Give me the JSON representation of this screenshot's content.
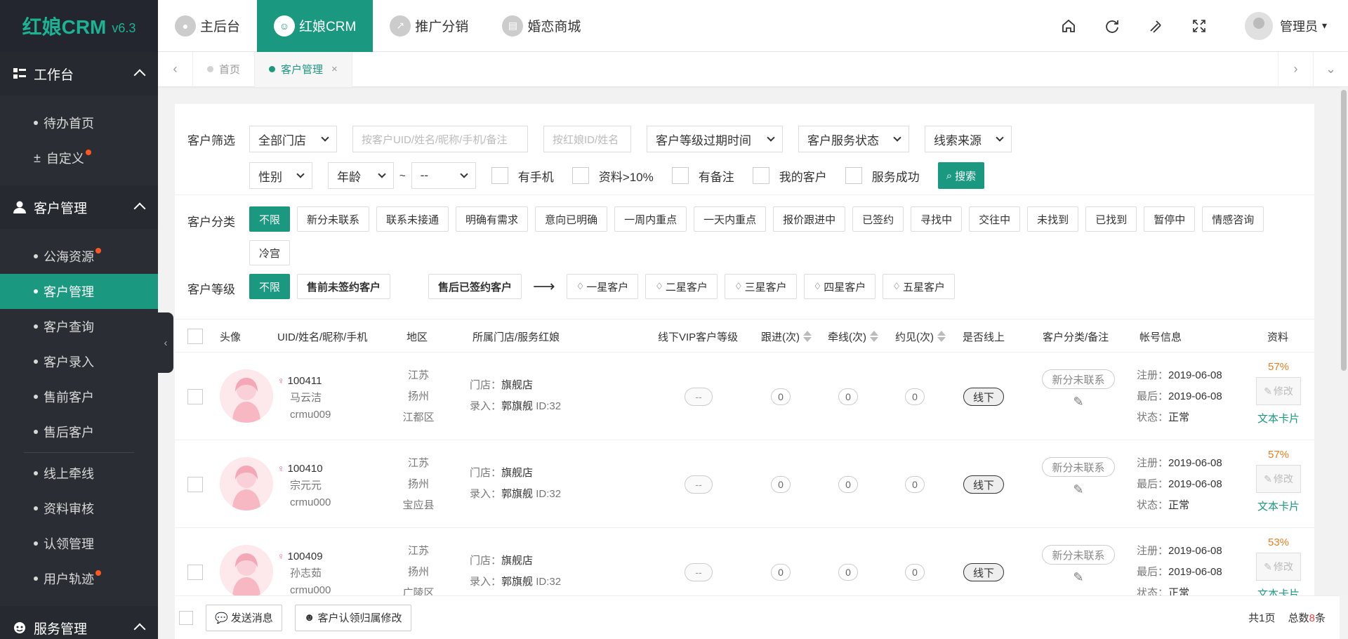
{
  "brand": {
    "name": "红娘CRM",
    "version": "v6.3",
    "accent": "#1a9980"
  },
  "sidebar": {
    "groups": [
      {
        "label": "工作台",
        "items": [
          {
            "label": "待办首页",
            "marker": "bullet",
            "dot": false
          },
          {
            "label": "自定义",
            "marker": "plusminus",
            "dot": true
          }
        ]
      },
      {
        "label": "客户管理",
        "items": [
          {
            "label": "公海资源",
            "dot": true
          },
          {
            "label": "客户管理",
            "active": true
          },
          {
            "label": "客户查询"
          },
          {
            "label": "客户录入"
          },
          {
            "label": "售前客户"
          },
          {
            "label": "售后客户"
          },
          {
            "label": "线上牵线"
          },
          {
            "label": "资料审核"
          },
          {
            "label": "认领管理"
          },
          {
            "label": "用户轨迹",
            "dot": true
          }
        ]
      },
      {
        "label": "服务管理",
        "items": []
      }
    ]
  },
  "topnav": [
    {
      "label": "主后台",
      "icon": "user-circle-icon"
    },
    {
      "label": "红娘CRM",
      "icon": "smile-icon",
      "active": true
    },
    {
      "label": "推广分销",
      "icon": "chart-icon"
    },
    {
      "label": "婚恋商城",
      "icon": "shop-icon"
    }
  ],
  "topright": {
    "user": "管理员",
    "icons": [
      "home-icon",
      "refresh-icon",
      "clear-icon",
      "fullscreen-icon"
    ]
  },
  "tabs": [
    {
      "label": "首页"
    },
    {
      "label": "客户管理",
      "active": true,
      "close": "×"
    }
  ],
  "filter": {
    "label": "客户筛选",
    "store_select": "全部门店",
    "search_placeholder": "按客户UID/姓名/昵称/手机/备注",
    "matchmaker_placeholder": "按红娘ID/姓名",
    "level_expire_select": "客户等级过期时间",
    "service_status_select": "客户服务状态",
    "lead_source_select": "线索来源",
    "gender_select": "性别",
    "age_select": "年龄",
    "tilde": "~",
    "age_to_select": "--",
    "checks": [
      "有手机",
      "资料>10%",
      "有备注",
      "我的客户",
      "服务成功"
    ],
    "search_btn": "搜索"
  },
  "category": {
    "label": "客户分类",
    "chips": [
      "不限",
      "新分未联系",
      "联系未接通",
      "明确有需求",
      "意向已明确",
      "一周内重点",
      "一天内重点",
      "报价跟进中",
      "已签约",
      "寻找中",
      "交往中",
      "未找到",
      "已找到",
      "暂停中",
      "情感咨询",
      "冷宫"
    ]
  },
  "level": {
    "label": "客户等级",
    "all": "不限",
    "presale": "售前未签约客户",
    "aftersale": "售后已签约客户",
    "arrow": "⟶",
    "stars": [
      "一星客户",
      "二星客户",
      "三星客户",
      "四星客户",
      "五星客户"
    ]
  },
  "table": {
    "headers": {
      "avatar": "头像",
      "uid": "UID/姓名/昵称/手机",
      "region": "地区",
      "store": "所属门店/服务红娘",
      "vip": "线下VIP客户等级",
      "follow": "跟进(次)",
      "match": "牵线(次)",
      "meet": "约见(次)",
      "online": "是否线上",
      "category": "客户分类/备注",
      "account": "帐号信息",
      "profile": "资料"
    },
    "rows": [
      {
        "uid": "100411",
        "name": "马云洁",
        "nick": "crmu009",
        "province": "江苏",
        "city": "扬州",
        "district": "江都区",
        "store_label": "门店：",
        "store": "旗舰店",
        "entry_label": "录入：",
        "entry": "郭旗舰",
        "entry_id": "ID:32",
        "vip": "--",
        "follow": "0",
        "match": "0",
        "meet": "0",
        "online": "线下",
        "category": "新分未联系",
        "reg_label": "注册：",
        "reg": "2019-06-08",
        "last_label": "最后：",
        "last": "2019-06-08",
        "status_label": "状态：",
        "status": "正常",
        "percent": "57%",
        "edit": "修改",
        "card": "文本卡片"
      },
      {
        "uid": "100410",
        "name": "宗元元",
        "nick": "crmu000",
        "province": "江苏",
        "city": "扬州",
        "district": "宝应县",
        "store_label": "门店：",
        "store": "旗舰店",
        "entry_label": "录入：",
        "entry": "郭旗舰",
        "entry_id": "ID:32",
        "vip": "--",
        "follow": "0",
        "match": "0",
        "meet": "0",
        "online": "线下",
        "category": "新分未联系",
        "reg_label": "注册：",
        "reg": "2019-06-08",
        "last_label": "最后：",
        "last": "2019-06-08",
        "status_label": "状态：",
        "status": "正常",
        "percent": "57%",
        "edit": "修改",
        "card": "文本卡片"
      },
      {
        "uid": "100409",
        "name": "孙志茹",
        "nick": "crmu000",
        "province": "江苏",
        "city": "扬州",
        "district": "广陵区",
        "store_label": "门店：",
        "store": "旗舰店",
        "entry_label": "录入：",
        "entry": "郭旗舰",
        "entry_id": "ID:32",
        "vip": "--",
        "follow": "0",
        "match": "0",
        "meet": "0",
        "online": "线下",
        "category": "新分未联系",
        "reg_label": "注册：",
        "reg": "2019-06-08",
        "last_label": "最后：",
        "last": "2019-06-08",
        "status_label": "状态：",
        "status": "正常",
        "percent": "53%",
        "edit": "修改",
        "card": "文本卡片"
      }
    ]
  },
  "footer": {
    "send_msg": "发送消息",
    "claim_edit": "客户认领归属修改",
    "pages": "共1页",
    "total_prefix": "总数",
    "total": "8",
    "total_suffix": "条"
  }
}
